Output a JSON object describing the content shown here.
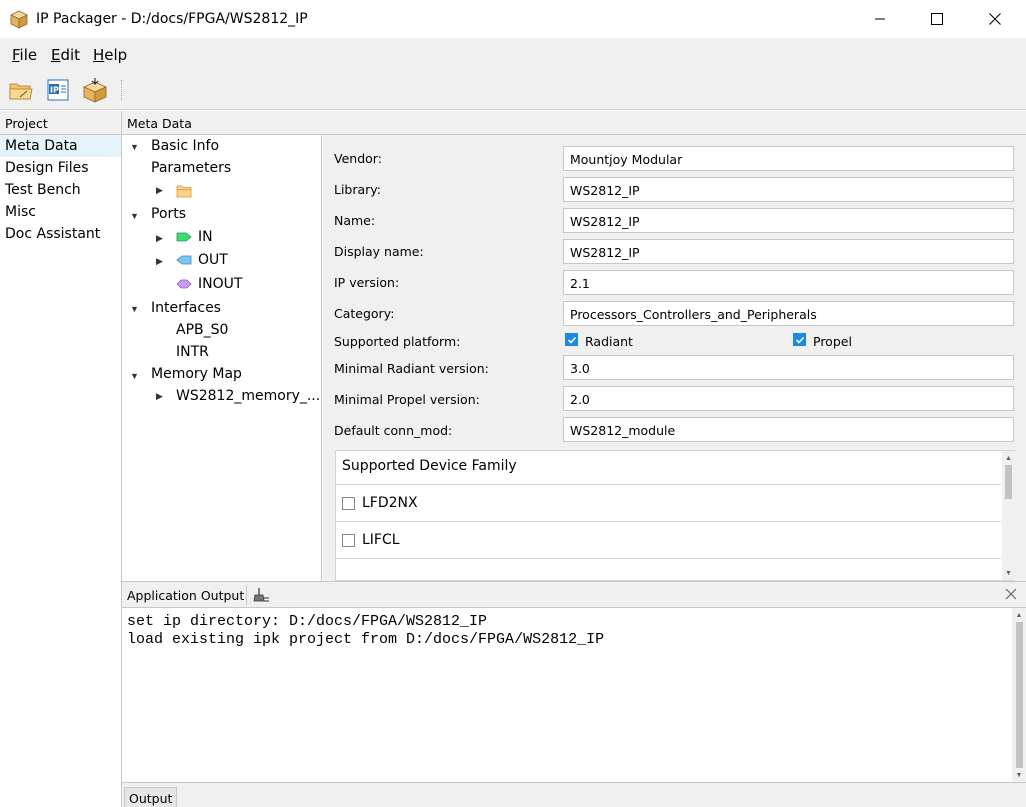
{
  "window": {
    "title": "IP Packager - D:/docs/FPGA/WS2812_IP"
  },
  "menu": {
    "items": [
      {
        "label": "File",
        "mnemonic": "F",
        "rest": "ile"
      },
      {
        "label": "Edit",
        "mnemonic": "E",
        "rest": "dit"
      },
      {
        "label": "Help",
        "mnemonic": "H",
        "rest": "elp"
      }
    ]
  },
  "toolbar": {
    "icons": [
      "open-folder-icon",
      "ip-document-icon",
      "package-icon"
    ]
  },
  "project": {
    "header": "Project",
    "items": [
      "Meta Data",
      "Design Files",
      "Test Bench",
      "Misc",
      "Doc Assistant"
    ],
    "selected": "Meta Data"
  },
  "meta": {
    "header": "Meta Data",
    "tree": {
      "basic_info": "Basic Info",
      "parameters": "Parameters",
      "ports": "Ports",
      "port_in": "IN",
      "port_out": "OUT",
      "port_inout": "INOUT",
      "interfaces": "Interfaces",
      "apb": "APB_S0",
      "intr": "INTR",
      "memory_map": "Memory Map",
      "memory_item": "WS2812_memory_..."
    },
    "form": {
      "vendor_label": "Vendor:",
      "vendor": "Mountjoy Modular",
      "library_label": "Library:",
      "library": "WS2812_IP",
      "name_label": "Name:",
      "name": "WS2812_IP",
      "display_name_label": "Display name:",
      "display_name": "WS2812_IP",
      "ip_version_label": "IP version:",
      "ip_version": "2.1",
      "category_label": "Category:",
      "category": "Processors_Controllers_and_Peripherals",
      "platform_label": "Supported platform:",
      "platform_radiant": "Radiant",
      "platform_propel": "Propel",
      "min_radiant_label": "Minimal Radiant version:",
      "min_radiant": "3.0",
      "min_propel_label": "Minimal Propel version:",
      "min_propel": "2.0",
      "conn_mod_label": "Default conn_mod:",
      "conn_mod": "WS2812_module"
    },
    "device_family": {
      "header": "Supported Device Family",
      "items": [
        "LFD2NX",
        "LIFCL"
      ]
    }
  },
  "output": {
    "title": "Application Output",
    "lines": [
      "set ip directory: D:/docs/FPGA/WS2812_IP",
      "load existing ipk project from D:/docs/FPGA/WS2812_IP"
    ],
    "tab": "Output"
  },
  "colors": {
    "accent": "#1e88e5",
    "selection": "#e5f3fb",
    "panel_bg": "#f0f0f0",
    "port_in": "#3ddc6e",
    "port_out": "#7cc4f2",
    "port_inout": "#c89cf0"
  }
}
